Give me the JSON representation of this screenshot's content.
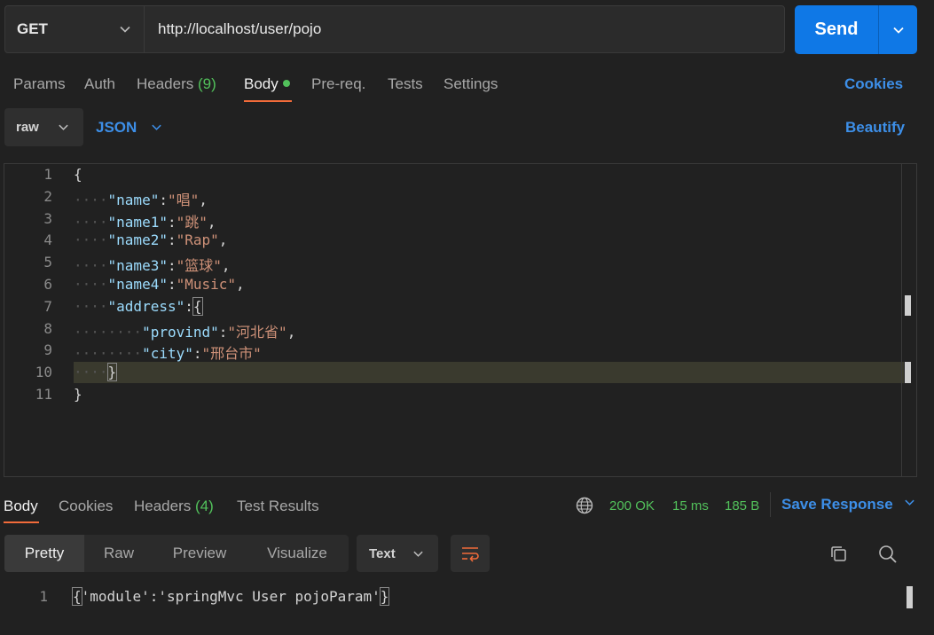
{
  "request": {
    "method": "GET",
    "url": "http://localhost/user/pojo",
    "send_label": "Send"
  },
  "tabs": {
    "params": "Params",
    "auth": "Auth",
    "headers": "Headers",
    "headers_count": "(9)",
    "body": "Body",
    "prereq": "Pre-req.",
    "tests": "Tests",
    "settings": "Settings",
    "cookies": "Cookies"
  },
  "body_toolbar": {
    "mode": "raw",
    "format": "JSON",
    "beautify": "Beautify"
  },
  "editor": {
    "line_numbers": [
      "1",
      "2",
      "3",
      "4",
      "5",
      "6",
      "7",
      "8",
      "9",
      "10",
      "11"
    ],
    "lines": [
      {
        "indent": "",
        "key": "",
        "value": "",
        "text": "{"
      },
      {
        "indent": "····",
        "key": "\"name\"",
        "sep": ":",
        "value": "\"唱\"",
        "tail": ","
      },
      {
        "indent": "····",
        "key": "\"name1\"",
        "sep": ":",
        "value": "\"跳\"",
        "tail": ","
      },
      {
        "indent": "····",
        "key": "\"name2\"",
        "sep": ":",
        "value": "\"Rap\"",
        "tail": ","
      },
      {
        "indent": "····",
        "key": "\"name3\"",
        "sep": ":",
        "value": "\"篮球\"",
        "tail": ","
      },
      {
        "indent": "····",
        "key": "\"name4\"",
        "sep": ":",
        "value": "\"Music\"",
        "tail": ","
      },
      {
        "indent": "····",
        "key": "\"address\"",
        "sep": ":",
        "value": "",
        "tail": "{"
      },
      {
        "indent": "········",
        "key": "\"provind\"",
        "sep": ":",
        "value": "\"河北省\"",
        "tail": ","
      },
      {
        "indent": "········",
        "key": "\"city\"",
        "sep": ":",
        "value": "\"邢台市\"",
        "tail": ""
      },
      {
        "indent": "····",
        "key": "",
        "value": "",
        "text": "}"
      },
      {
        "indent": "",
        "key": "",
        "value": "",
        "text": "}"
      }
    ]
  },
  "response": {
    "tabs": {
      "body": "Body",
      "cookies": "Cookies",
      "headers": "Headers",
      "headers_count": "(4)",
      "test_results": "Test Results"
    },
    "status": "200 OK",
    "time": "15 ms",
    "size": "185 B",
    "save": "Save Response",
    "views": [
      "Pretty",
      "Raw",
      "Preview",
      "Visualize"
    ],
    "text_type": "Text",
    "line_number": "1",
    "content": "{'module':'springMvc User pojoParam'}"
  }
}
